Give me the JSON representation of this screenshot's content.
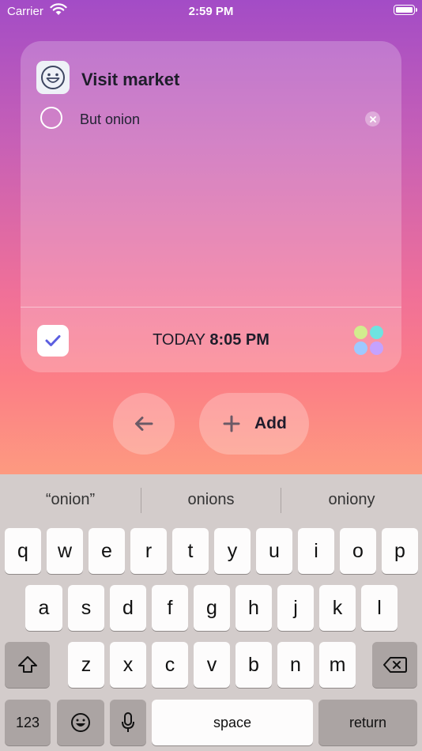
{
  "status_bar": {
    "carrier": "Carrier",
    "time": "2:59 PM"
  },
  "card": {
    "title": "Visit market",
    "task": {
      "text": "But onion"
    },
    "due": {
      "label": "TODAY",
      "time": "8:05 PM"
    },
    "palette_colors": [
      "#d2ec8e",
      "#6fe3e0",
      "#9ec9ff",
      "#c5a2ff"
    ]
  },
  "actions": {
    "add_label": "Add"
  },
  "keyboard": {
    "suggestions": [
      "“onion”",
      "onions",
      "oniony"
    ],
    "row1": [
      "q",
      "w",
      "e",
      "r",
      "t",
      "y",
      "u",
      "i",
      "o",
      "p"
    ],
    "row2": [
      "a",
      "s",
      "d",
      "f",
      "g",
      "h",
      "j",
      "k",
      "l"
    ],
    "row3": [
      "z",
      "x",
      "c",
      "v",
      "b",
      "n",
      "m"
    ],
    "numbers_label": "123",
    "space_label": "space",
    "return_label": "return"
  },
  "colors": {
    "gradient_top": "#a34cc6",
    "gradient_bottom": "#fd9a80",
    "keyboard_bg": "#d3cccb"
  }
}
